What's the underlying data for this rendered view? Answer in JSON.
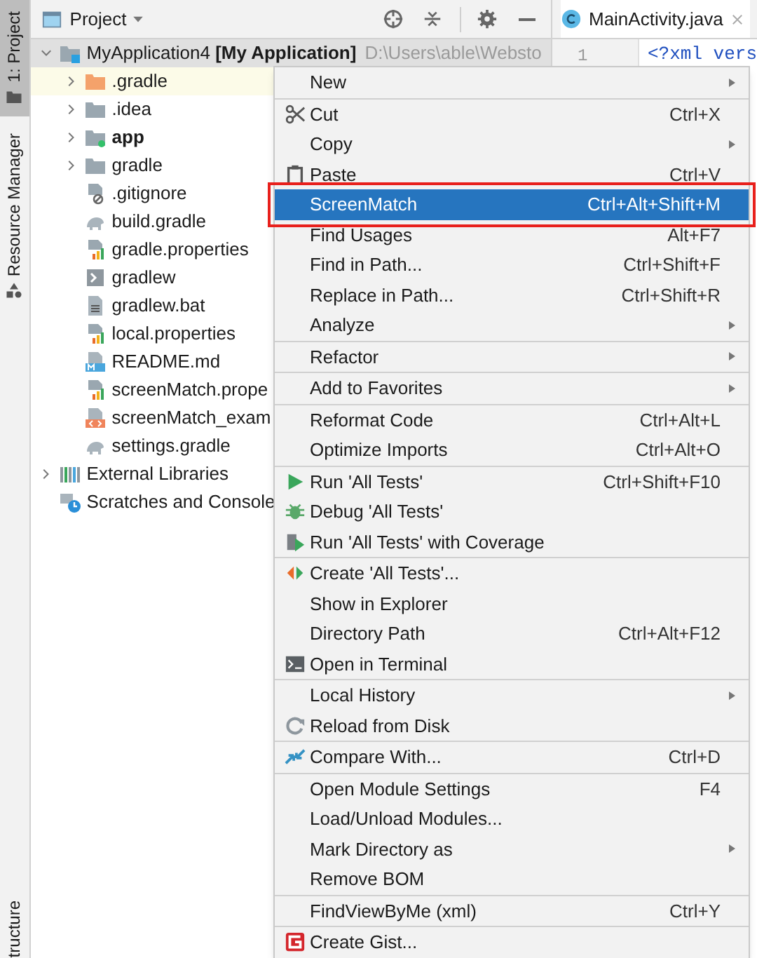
{
  "side_tabs": [
    {
      "label": "1: Project",
      "selected": true,
      "kind": "project"
    },
    {
      "label": "Resource Manager",
      "selected": false,
      "kind": "resources"
    },
    {
      "label": "tructure",
      "selected": false,
      "kind": "structure"
    }
  ],
  "project_panel": {
    "title": "Project"
  },
  "tree": [
    {
      "label": "MyApplication4 **[My Application]**",
      "path": "D:\\Users\\able\\Websto",
      "kind": "project",
      "expanded": true,
      "selected": true,
      "highlighted": false,
      "children": [
        {
          "label": ".gradle",
          "kind": "folder_excluded",
          "expanded": false,
          "selected": false,
          "highlighted": true
        },
        {
          "label": ".idea",
          "kind": "folder",
          "expanded": false,
          "selected": false,
          "highlighted": false
        },
        {
          "label": "app",
          "kind": "module",
          "expanded": false,
          "selected": false,
          "highlighted": false
        },
        {
          "label": "gradle",
          "kind": "folder",
          "expanded": false,
          "selected": false,
          "highlighted": false
        },
        {
          "label": ".gitignore",
          "kind": "ignore",
          "selected": false,
          "highlighted": false
        },
        {
          "label": "build.gradle",
          "kind": "gradle",
          "selected": false,
          "highlighted": false
        },
        {
          "label": "gradle.properties",
          "kind": "properties",
          "selected": false,
          "highlighted": false
        },
        {
          "label": "gradlew",
          "kind": "script",
          "selected": false,
          "highlighted": false
        },
        {
          "label": "gradlew.bat",
          "kind": "text",
          "selected": false,
          "highlighted": false
        },
        {
          "label": "local.properties",
          "kind": "properties",
          "selected": false,
          "highlighted": false
        },
        {
          "label": "README.md",
          "kind": "markdown",
          "selected": false,
          "highlighted": false
        },
        {
          "label": "screenMatch.prope",
          "kind": "properties",
          "selected": false,
          "highlighted": false
        },
        {
          "label": "screenMatch_exam",
          "kind": "xml",
          "selected": false,
          "highlighted": false
        },
        {
          "label": "settings.gradle",
          "kind": "gradle",
          "selected": false,
          "highlighted": false
        }
      ]
    },
    {
      "label": "External Libraries",
      "kind": "libraries",
      "expanded": false,
      "selected": false,
      "highlighted": false
    },
    {
      "label": "Scratches and Console",
      "kind": "scratches",
      "selected": false,
      "highlighted": false
    }
  ],
  "editor": {
    "tab": {
      "label": "MainActivity.java",
      "selected": true
    },
    "line_number": "1",
    "code": "<?xml vers"
  },
  "menu": {
    "groups": [
      {
        "items": [
          {
            "label": "New",
            "submenu": true,
            "selected": false
          }
        ]
      },
      {
        "items": [
          {
            "label": "Cut",
            "shortcut": "Ctrl+X",
            "submenu": false,
            "selected": false
          },
          {
            "label": "Copy",
            "submenu": true,
            "selected": false
          },
          {
            "label": "Paste",
            "shortcut": "Ctrl+V",
            "submenu": false,
            "selected": false
          },
          {
            "label": "ScreenMatch",
            "shortcut": "Ctrl+Alt+Shift+M",
            "submenu": false,
            "selected": true
          },
          {
            "label": "Find Usages",
            "shortcut": "Alt+F7",
            "submenu": false,
            "selected": false
          },
          {
            "label": "Find in Path...",
            "shortcut": "Ctrl+Shift+F",
            "submenu": false,
            "selected": false
          },
          {
            "label": "Replace in Path...",
            "shortcut": "Ctrl+Shift+R",
            "submenu": false,
            "selected": false
          },
          {
            "label": "Analyze",
            "submenu": true,
            "selected": false
          }
        ]
      },
      {
        "items": [
          {
            "label": "Refactor",
            "submenu": true,
            "selected": false
          }
        ]
      },
      {
        "items": [
          {
            "label": "Add to Favorites",
            "submenu": true,
            "selected": false
          }
        ]
      },
      {
        "items": [
          {
            "label": "Reformat Code",
            "shortcut": "Ctrl+Alt+L",
            "submenu": false,
            "selected": false
          },
          {
            "label": "Optimize Imports",
            "shortcut": "Ctrl+Alt+O",
            "submenu": false,
            "selected": false
          }
        ]
      },
      {
        "items": [
          {
            "label": "Run 'All Tests'",
            "shortcut": "Ctrl+Shift+F10",
            "submenu": false,
            "selected": false
          },
          {
            "label": "Debug 'All Tests'",
            "submenu": false,
            "selected": false
          },
          {
            "label": "Run 'All Tests' with Coverage",
            "submenu": false,
            "selected": false
          }
        ]
      },
      {
        "items": [
          {
            "label": "Create 'All Tests'...",
            "submenu": false,
            "selected": false
          },
          {
            "label": "Show in Explorer",
            "submenu": false,
            "selected": false
          },
          {
            "label": "Directory Path",
            "shortcut": "Ctrl+Alt+F12",
            "submenu": false,
            "selected": false
          },
          {
            "label": "Open in Terminal",
            "submenu": false,
            "selected": false
          }
        ]
      },
      {
        "items": [
          {
            "label": "Local History",
            "submenu": true,
            "selected": false
          },
          {
            "label": "Reload from Disk",
            "submenu": false,
            "selected": false
          }
        ]
      },
      {
        "items": [
          {
            "label": "Compare With...",
            "shortcut": "Ctrl+D",
            "submenu": false,
            "selected": false
          }
        ]
      },
      {
        "items": [
          {
            "label": "Open Module Settings",
            "shortcut": "F4",
            "submenu": false,
            "selected": false
          },
          {
            "label": "Load/Unload Modules...",
            "submenu": false,
            "selected": false
          },
          {
            "label": "Mark Directory as",
            "submenu": true,
            "selected": false
          },
          {
            "label": "Remove BOM",
            "submenu": false,
            "selected": false
          }
        ]
      },
      {
        "items": [
          {
            "label": "FindViewByMe (xml)",
            "shortcut": "Ctrl+Y",
            "submenu": false,
            "selected": false
          }
        ]
      },
      {
        "items": [
          {
            "label": "Create Gist...",
            "submenu": false,
            "selected": false
          }
        ]
      }
    ]
  }
}
